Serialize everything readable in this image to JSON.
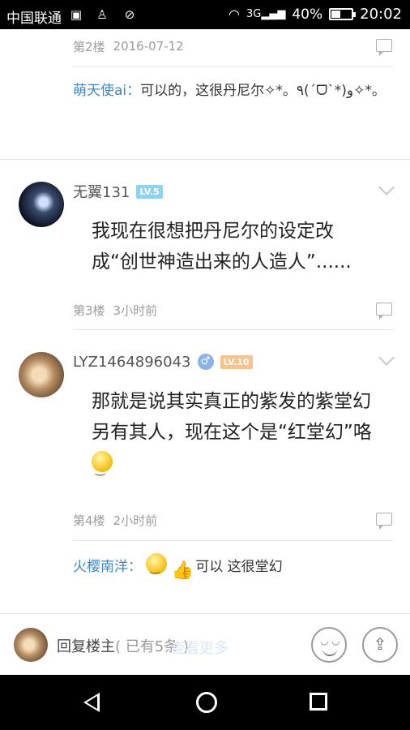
{
  "status_bar": {
    "carrier": "中国联通",
    "network": "3G",
    "battery": "40%",
    "time": "20:02"
  },
  "posts": {
    "floor2": {
      "floor": "第2楼",
      "time": "2016-07-12"
    },
    "reply1": {
      "user": "萌天使ai",
      "sep": "：",
      "text": "可以的，这很丹尼尔✧*。٩(ˊᗜˋ*)و✧*。"
    },
    "floor3": {
      "username": "无翼131",
      "level": "LV.5",
      "body": "我现在很想把丹尼尔的设定改成“创世神造出来的人造人”......",
      "floor": "第3楼",
      "time": "3小时前"
    },
    "floor4": {
      "username": "LYZ1464896043",
      "gender": "♂",
      "level": "LV.10",
      "body": "那就是说其实真正的紫发的紫堂幻另有其人，现在这个是“红堂幻”咯",
      "floor": "第4楼",
      "time": "2小时前"
    },
    "reply2": {
      "user": "火樱南洋",
      "sep": "：",
      "text": "可以 这很堂幻"
    }
  },
  "bottom_bar": {
    "reply_label": "回复楼主",
    "reply_count": "( 已有5条 )",
    "ghost_text": "查看更多"
  }
}
